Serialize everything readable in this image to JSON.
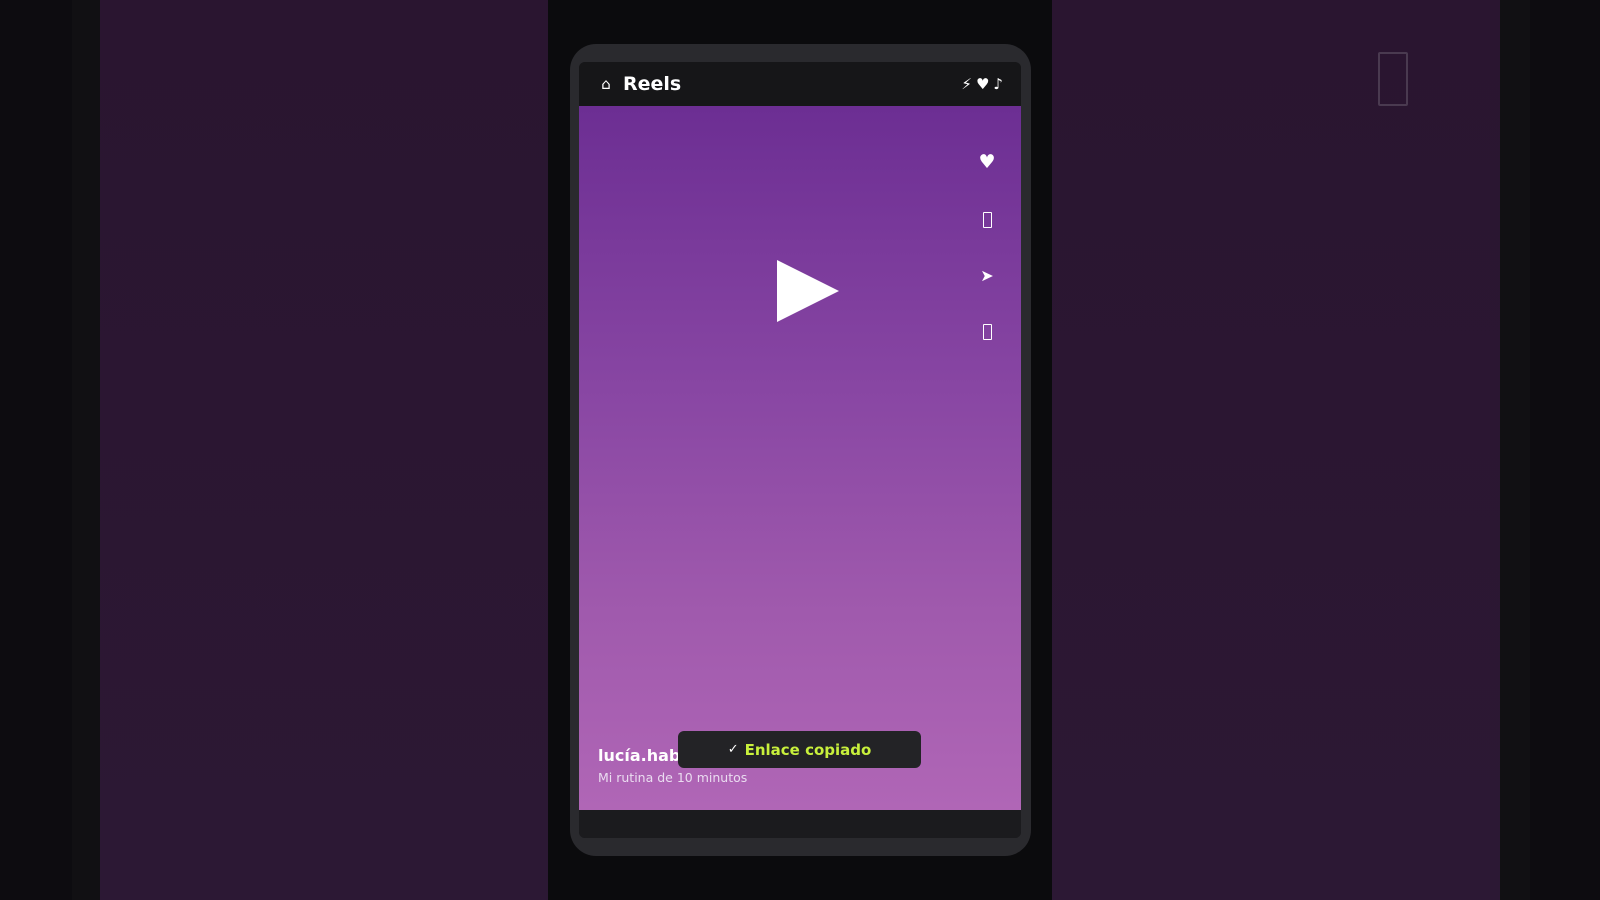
{
  "app": {
    "title": "Reels"
  },
  "topbar": {
    "home_icon": "⌂",
    "status_icons": [
      "⚡",
      "♥",
      "♪"
    ]
  },
  "video": {
    "author": "lucía.hab",
    "caption": "Mi rutina de 10 minutos"
  },
  "actions": {
    "like_glyph": "♥",
    "share_glyph": "➤"
  },
  "toast": {
    "check": "✓",
    "message": "Enlace copiado"
  },
  "colors": {
    "accent_toast_text": "#c8f03c",
    "video_gradient_top": "#6c2e93",
    "video_gradient_bottom": "#b066b6",
    "topbar_bg": "#161618"
  },
  "icons": {
    "home": "home-icon",
    "flash": "flash-icon",
    "heart": "heart-icon",
    "music": "music-icon",
    "play": "play-icon",
    "like": "heart-icon",
    "comment": "comment-icon",
    "share": "send-icon",
    "save": "bookmark-icon"
  }
}
